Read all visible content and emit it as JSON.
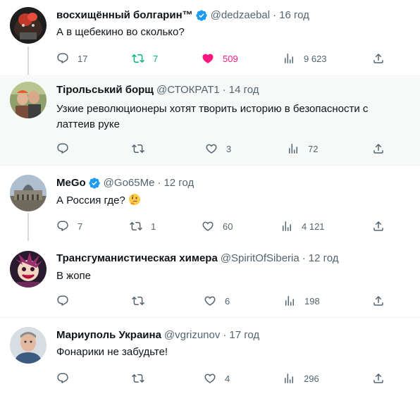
{
  "colors": {
    "text": "#0f1419",
    "secondary": "#536471",
    "verified": "#1d9bf0",
    "retweet_active": "#00ba7c",
    "like_active": "#f91880",
    "highlight_bg": "#f7f9f9"
  },
  "tweets": [
    {
      "name": "восхищённый болгарин™",
      "verified": true,
      "handle": "@dedzaebal",
      "dot": "·",
      "time": "16 год",
      "text": "А в щебекино во сколько?",
      "replies": "17",
      "retweets": "7",
      "likes": "509",
      "views": "9 623"
    },
    {
      "name": "Тірольський борщ",
      "verified": false,
      "handle": "@СТОКРАТ1",
      "dot": "·",
      "time": "14 год",
      "text_line1": "Узкие революционеры хотят творить историю в безопасности с",
      "text_line2": "латтеив руке",
      "replies": "",
      "retweets": "",
      "likes": "3",
      "views": "72"
    },
    {
      "name": "MeGo",
      "verified": true,
      "handle": "@Go65Me",
      "dot": "·",
      "time": "12 год",
      "text": "А Россия где?",
      "emoji": "thinking-face-emoji",
      "replies": "7",
      "retweets": "1",
      "likes": "60",
      "views": "4 121"
    },
    {
      "name": "Трансгуманистическая химера",
      "verified": false,
      "handle": "@SpiritOfSiberia",
      "dot": "·",
      "time": "12 год",
      "text": "В жопе",
      "replies": "",
      "retweets": "",
      "likes": "6",
      "views": "198"
    },
    {
      "name": "Мариуполь Украина",
      "verified": false,
      "handle": "@vgrizunov",
      "dot": "·",
      "time": "17 год",
      "text": "Фонарики не забудьте!",
      "replies": "",
      "retweets": "",
      "likes": "4",
      "views": "296"
    }
  ]
}
